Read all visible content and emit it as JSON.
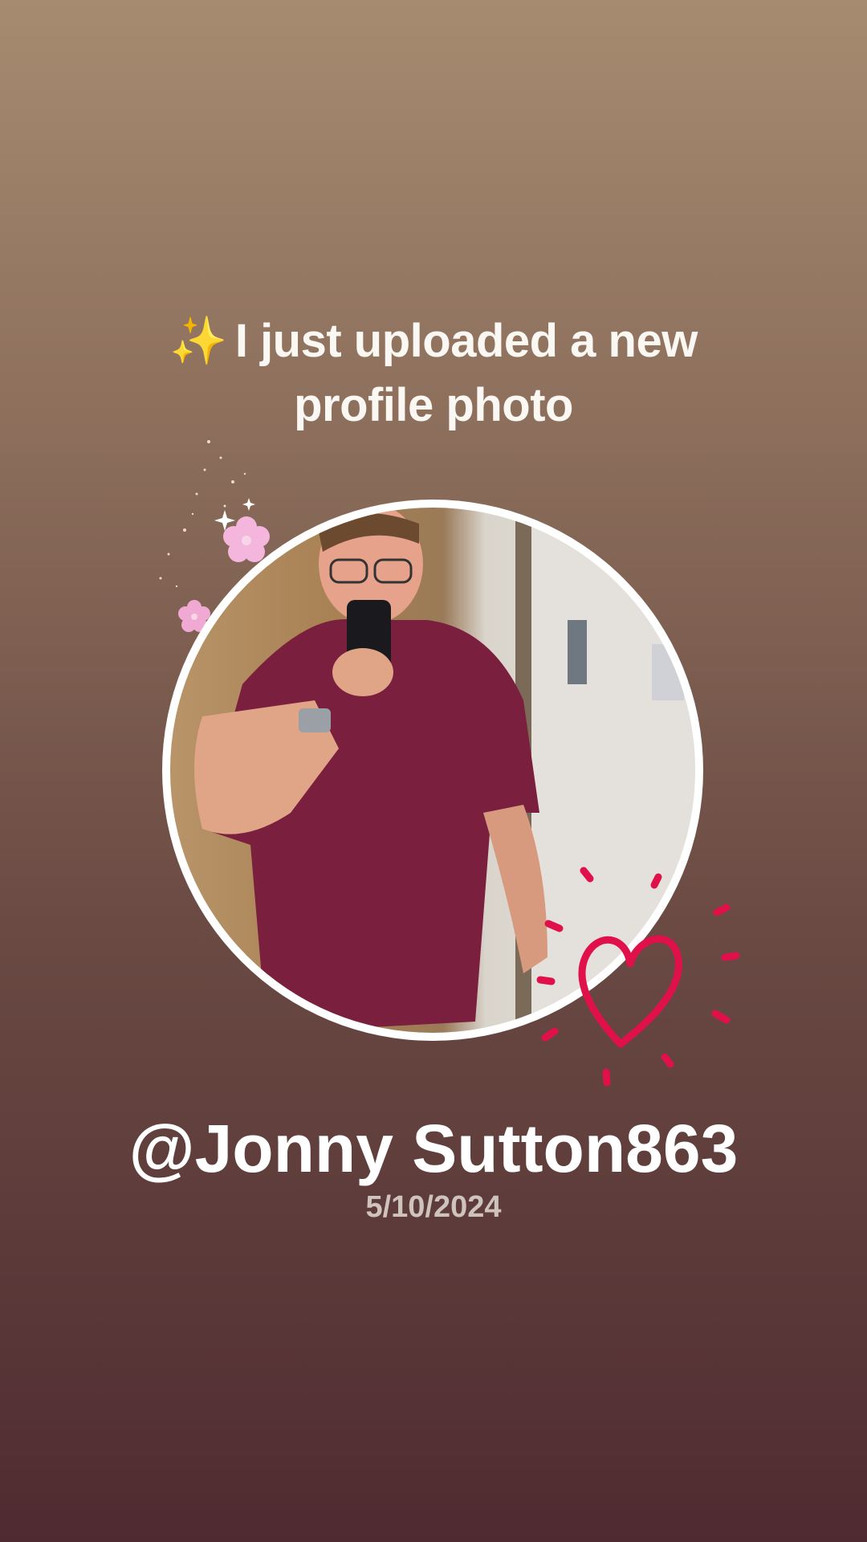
{
  "headline": {
    "emoji": "✨",
    "text": "I just uploaded a new profile photo"
  },
  "profile": {
    "username": "@Jonny Sutton863",
    "date": "5/10/2024"
  },
  "decorations": {
    "flower_icon": "pink-flower-icon",
    "heart_icon": "hand-drawn-heart-icon",
    "sparkle_icon": "sparkle-icon",
    "heart_color": "#e0104a",
    "flower_color": "#f4b6dc"
  }
}
